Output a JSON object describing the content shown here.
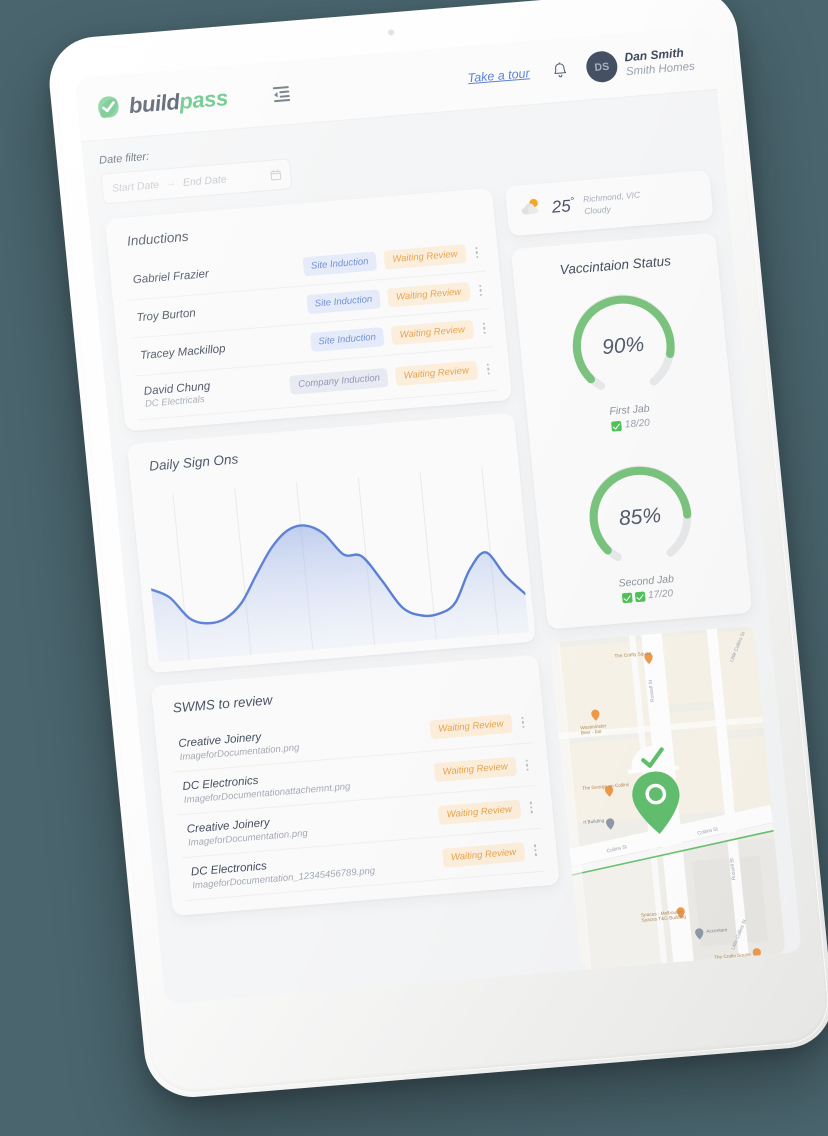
{
  "app": {
    "logo_build": "build",
    "logo_pass": "pass",
    "logo_mark_icon": "leaf-check-icon",
    "fold_icon": "menu-fold-icon",
    "tour_link": "Take a tour",
    "bell_icon": "bell-icon",
    "avatar_initials": "DS",
    "user_name": "Dan Smith",
    "user_org": "Smith Homes"
  },
  "filters": {
    "label": "Date filter:",
    "start_placeholder": "Start Date",
    "end_placeholder": "End Date",
    "range_arrow": "→",
    "calendar_icon": "calendar-icon"
  },
  "inductions": {
    "title": "Inductions",
    "rows": [
      {
        "name": "Gabriel Frazier",
        "org": "",
        "type": "Site Induction",
        "type_kind": "site",
        "status": "Waiting Review"
      },
      {
        "name": "Troy Burton",
        "org": "",
        "type": "Site Induction",
        "type_kind": "site",
        "status": "Waiting Review"
      },
      {
        "name": "Tracey Mackillop",
        "org": "",
        "type": "Site Induction",
        "type_kind": "site",
        "status": "Waiting Review"
      },
      {
        "name": "David Chung",
        "org": "DC Electricals",
        "type": "Company Induction",
        "type_kind": "company",
        "status": "Waiting Review"
      }
    ]
  },
  "weather": {
    "temperature": "25",
    "degree_symbol": "°",
    "location": "Richmond, VIC",
    "condition": "Cloudy",
    "icon": "sun-behind-cloud-icon"
  },
  "vaccination": {
    "title": "Vaccintaion Status",
    "gauges": [
      {
        "percent_label": "90%",
        "percent": 90,
        "label": "First Jab",
        "count": "18/20",
        "ticks": 1,
        "color": "#7ac37e"
      },
      {
        "percent_label": "85%",
        "percent": 85,
        "label": "Second Jab",
        "count": "17/20",
        "ticks": 2,
        "color": "#7ac37e"
      }
    ]
  },
  "swms": {
    "title": "SWMS to review",
    "rows": [
      {
        "name": "Creative Joinery",
        "file": "ImageforDocumentation.png",
        "status": "Waiting Review"
      },
      {
        "name": "DC Electronics",
        "file": "ImageforDocumentationattachemnt.png",
        "status": "Waiting Review"
      },
      {
        "name": "Creative Joinery",
        "file": "ImageforDocumentation.png",
        "status": "Waiting Review"
      },
      {
        "name": "DC Electronics",
        "file": "ImageforDocumentation_12345456789.png",
        "status": "Waiting Review"
      }
    ]
  },
  "map": {
    "marker_icon": "hard-hat-pin-icon",
    "labels": [
      "The Crafty Squire",
      "Westminster Beer - bar",
      "The George on Collins",
      "rt Building",
      "Collins St",
      "Russell St",
      "Little Collins St",
      "Spaces - Melbourne Spaces T&G Building",
      "Accenture"
    ]
  },
  "colors": {
    "background": "#4a656e",
    "accent_green": "#5bc37f",
    "link_blue": "#5b7fd4",
    "badge_blue_bg": "#e4eaf9",
    "badge_blue_text": "#6f8ed2",
    "badge_orange_bg": "#fceedb",
    "badge_orange_text": "#e7a34e",
    "chart_line": "#5b7fd4"
  },
  "chart_data": {
    "type": "area",
    "title": "Daily Sign Ons",
    "xlabel": "",
    "ylabel": "",
    "grid": "vertical-only",
    "legend": "none",
    "x": [
      0,
      1,
      2,
      3,
      4,
      5,
      6,
      7,
      8,
      9,
      10,
      11,
      12,
      13,
      14,
      15,
      16,
      17,
      18,
      19,
      20
    ],
    "values": [
      46,
      40,
      26,
      22,
      24,
      33,
      50,
      66,
      76,
      78,
      72,
      58,
      56,
      40,
      22,
      16,
      16,
      22,
      42,
      52,
      36,
      24
    ],
    "ylim": [
      0,
      100
    ],
    "gridline_count": 6
  }
}
